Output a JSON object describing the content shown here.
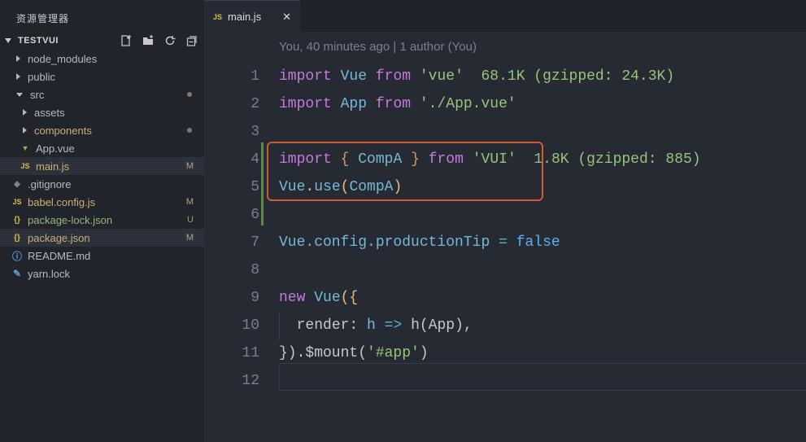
{
  "sidebar": {
    "title": "资源管理器",
    "section_title": "TESTVUI",
    "items": [
      {
        "label": "node_modules",
        "type": "folder"
      },
      {
        "label": "public",
        "type": "folder"
      },
      {
        "label": "src",
        "type": "folder-open"
      },
      {
        "label": "assets",
        "type": "folder"
      },
      {
        "label": "components",
        "type": "folder"
      },
      {
        "label": "App.vue",
        "type": "vue"
      },
      {
        "label": "main.js",
        "type": "js",
        "badge": "M"
      },
      {
        "label": ".gitignore",
        "type": "git"
      },
      {
        "label": "babel.config.js",
        "type": "js",
        "badge": "M"
      },
      {
        "label": "package-lock.json",
        "type": "json",
        "badge": "U"
      },
      {
        "label": "package.json",
        "type": "json",
        "badge": "M"
      },
      {
        "label": "README.md",
        "type": "info"
      },
      {
        "label": "yarn.lock",
        "type": "yarn"
      }
    ]
  },
  "editor": {
    "tab_label": "main.js",
    "tab_icon": "JS",
    "close_glyph": "✕",
    "codelens": "You, 40 minutes ago | 1 author (You)",
    "line_numbers": [
      "1",
      "2",
      "3",
      "4",
      "5",
      "6",
      "7",
      "8",
      "9",
      "10",
      "11",
      "12"
    ],
    "code": {
      "l1": {
        "k1": "import",
        "v1": "Vue",
        "k2": "from",
        "s1": "'vue'",
        "size": "68.1K (gzipped: 24.3K)"
      },
      "l2": {
        "k1": "import",
        "v1": "App",
        "k2": "from",
        "s1": "'./App.vue'"
      },
      "l4": {
        "k1": "import",
        "b1": "{",
        "v1": "CompA",
        "b2": "}",
        "k2": "from",
        "s1": "'VUI'",
        "size": "1.8K (gzipped: 885)"
      },
      "l5": {
        "t1": "Vue",
        "t2": ".",
        "t3": "use",
        "p1": "(",
        "t4": "CompA",
        "p2": ")"
      },
      "l7": {
        "t1": "Vue.config.productionTip",
        "op": "=",
        "v1": "false"
      },
      "l9": {
        "k1": "new",
        "v1": "Vue",
        "p1": "({"
      },
      "l10": {
        "t1": "render:",
        "t2": "h",
        "op": "=>",
        "t3": "h(App),"
      },
      "l11": {
        "t1": "}).$mount(",
        "s1": "'#app'",
        "t2": ")"
      }
    }
  }
}
